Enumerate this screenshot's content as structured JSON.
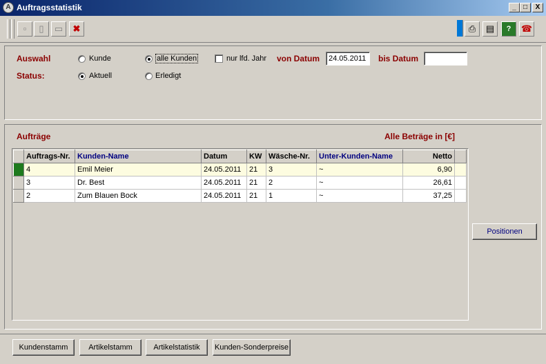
{
  "window": {
    "title": "Auftragsstatistik",
    "minimize": "_",
    "maximize": "□",
    "close": "X"
  },
  "toolbar": {
    "left_icons": [
      "document-icon",
      "copy-icon",
      "new-document-icon",
      "delete-icon"
    ],
    "right_icons": [
      "print-icon",
      "print-preview-icon",
      "help-icon",
      "phone-icon"
    ]
  },
  "filter": {
    "auswahl_label": "Auswahl",
    "kunde_label": "Kunde",
    "alle_kunden_label": "alle Kunden",
    "auswahl_selected": "alle Kunden",
    "nur_lfd_jahr_label": "nur lfd. Jahr",
    "nur_lfd_jahr_checked": false,
    "von_datum_label": "von Datum",
    "von_datum_value": "24.05.2011",
    "bis_datum_label": "bis Datum",
    "bis_datum_value": "",
    "status_label": "Status:",
    "aktuell_label": "Aktuell",
    "erledigt_label": "Erledigt",
    "status_selected": "Aktuell"
  },
  "orders": {
    "title": "Aufträge",
    "currency_note": "Alle Beträge in [€]",
    "columns": [
      "Auftrags-Nr.",
      "Kunden-Name",
      "Datum",
      "KW",
      "Wäsche-Nr.",
      "Unter-Kunden-Name",
      "Netto"
    ],
    "rows": [
      [
        "4",
        "Emil Meier",
        "24.05.2011",
        "21",
        "3",
        "~",
        "6,90"
      ],
      [
        "3",
        "Dr. Best",
        "24.05.2011",
        "21",
        "2",
        "~",
        "26,61"
      ],
      [
        "2",
        "Zum Blauen Bock",
        "24.05.2011",
        "21",
        "1",
        "~",
        "37,25"
      ]
    ],
    "selected_row": 0,
    "positionen_button": "Positionen"
  },
  "bottom_buttons": {
    "kundenstamm": "Kundenstamm",
    "artikelstamm": "Artikelstamm",
    "artikelstatistik": "Artikelstatistik",
    "kunden_sonderpreise": "Kunden-Sonderpreise"
  },
  "colors": {
    "titlebar_start": "#0a246a",
    "label_maroon": "#8b0000",
    "header_blue": "#000080",
    "row_indicator_green": "#1e7a1e",
    "selected_row_bg": "#fdfce0"
  }
}
